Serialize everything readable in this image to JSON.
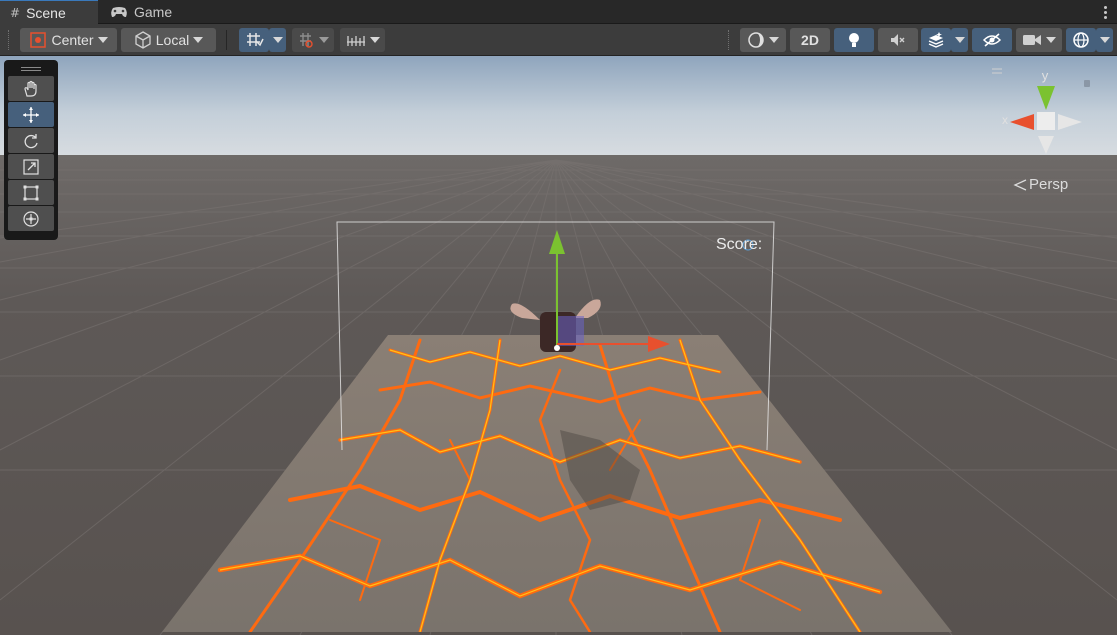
{
  "tabs": [
    {
      "label": "Scene",
      "icon": "grid-icon",
      "active": true
    },
    {
      "label": "Game",
      "icon": "gamepad-icon",
      "active": false
    }
  ],
  "toolbar": {
    "pivot_mode": "Center",
    "pivot_rotation": "Local",
    "toggle_2d": "2D"
  },
  "scene": {
    "score_label": "Score:",
    "projection_label": "Persp",
    "axis_x": "x",
    "axis_y": "y"
  },
  "colors": {
    "accent_blue": "#46607c",
    "axis_x": "#e8502e",
    "axis_y": "#7bc230",
    "lava": "#ff6a10",
    "sky_top": "#8fa5bd",
    "ground": "#5c5653"
  }
}
